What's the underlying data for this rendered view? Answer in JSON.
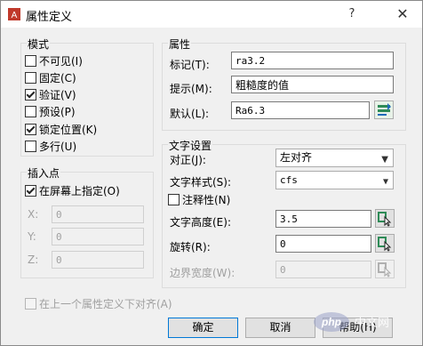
{
  "window": {
    "title": "属性定义",
    "help": "?",
    "close": "✕"
  },
  "mode": {
    "legend": "模式",
    "options": [
      {
        "label": "不可见(I)",
        "checked": false
      },
      {
        "label": "固定(C)",
        "checked": false
      },
      {
        "label": "验证(V)",
        "checked": true
      },
      {
        "label": "预设(P)",
        "checked": false
      },
      {
        "label": "锁定位置(K)",
        "checked": true
      },
      {
        "label": "多行(U)",
        "checked": false
      }
    ]
  },
  "insertion": {
    "legend": "插入点",
    "specify_on_screen": {
      "label": "在屏幕上指定(O)",
      "checked": true
    },
    "x": {
      "label": "X:",
      "value": "0"
    },
    "y": {
      "label": "Y:",
      "value": "0"
    },
    "z": {
      "label": "Z:",
      "value": "0"
    }
  },
  "attribute": {
    "legend": "属性",
    "tag": {
      "label": "标记(T):",
      "value": "ra3.2"
    },
    "prompt": {
      "label": "提示(M):",
      "value": "粗糙度的值"
    },
    "default": {
      "label": "默认(L):",
      "value": "Ra6.3"
    }
  },
  "text_settings": {
    "legend": "文字设置",
    "justification": {
      "label": "对正(J):",
      "value": "左对齐"
    },
    "text_style": {
      "label": "文字样式(S):",
      "value": "cfs"
    },
    "annotative": {
      "label": "注释性(N)",
      "checked": false
    },
    "text_height": {
      "label": "文字高度(E):",
      "value": "3.5"
    },
    "rotation": {
      "label": "旋转(R):",
      "value": "0"
    },
    "boundary_width": {
      "label": "边界宽度(W):",
      "value": "0"
    }
  },
  "align_below": {
    "label": "在上一个属性定义下对齐(A)",
    "checked": false
  },
  "buttons": {
    "ok": "确定",
    "cancel": "取消",
    "help": "帮助(H)"
  },
  "watermark": {
    "text": "php中文网"
  }
}
